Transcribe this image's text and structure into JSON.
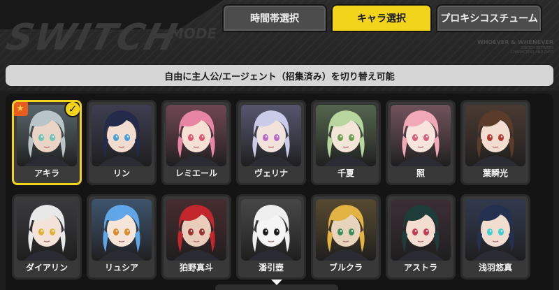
{
  "header": {
    "logo_text": "SWITCH",
    "logo_suffix": "MODE",
    "corner_title": "WHOEVER & WHENEVER",
    "corner_sub1": "SWITCH BETWEEN",
    "corner_sub2": "CHARACTERS AND DAYS"
  },
  "tabs": [
    {
      "label": "時間帯選択",
      "active": false
    },
    {
      "label": "キャラ選択",
      "active": true
    },
    {
      "label": "プロキシコスチューム",
      "active": false
    }
  ],
  "notice": "自由に主人公/エージェント（招集済み）を切り替え可能",
  "characters": [
    {
      "name": "アキラ",
      "selected": true,
      "hair": "#b9c4c8",
      "bg": "#5f6e74",
      "skin": "#e9d4c6",
      "eye": "#6fc3b5"
    },
    {
      "name": "リン",
      "selected": false,
      "hair": "#232a4a",
      "bg": "#3d3f55",
      "skin": "#f1dccf",
      "eye": "#4aa0d8"
    },
    {
      "name": "レミエール",
      "selected": false,
      "hair": "#e985a4",
      "bg": "#7a4a58",
      "skin": "#f6e0d6",
      "eye": "#e0566e"
    },
    {
      "name": "ヴェリナ",
      "selected": false,
      "hair": "#c9cbe8",
      "bg": "#5b5d7a",
      "skin": "#f2e2dc",
      "eye": "#b76bc7"
    },
    {
      "name": "千夏",
      "selected": false,
      "hair": "#b8d5a0",
      "bg": "#5a6e52",
      "skin": "#f3e5d8",
      "eye": "#6b9e4c"
    },
    {
      "name": "照",
      "selected": false,
      "hair": "#f1a9b7",
      "bg": "#7d5964",
      "skin": "#f7e4dc",
      "eye": "#d65f7a"
    },
    {
      "name": "葉瞬光",
      "selected": false,
      "hair": "#5b3b2a",
      "bg": "#4e3a30",
      "skin": "#f2ddd0",
      "eye": "#b5382e"
    },
    {
      "name": "ダイアリン",
      "selected": false,
      "hair": "#e8e8e8",
      "bg": "#3a3a3e",
      "skin": "#f3e2d8",
      "eye": "#e0b236"
    },
    {
      "name": "リュシア",
      "selected": false,
      "hair": "#5fa6e8",
      "bg": "#3f5a78",
      "skin": "#f5e4d8",
      "eye": "#d88b2a"
    },
    {
      "name": "狛野真斗",
      "selected": false,
      "hair": "#c4262e",
      "bg": "#4a2a2c",
      "skin": "#e9ccba",
      "eye": "#9a3232"
    },
    {
      "name": "潘引壺",
      "selected": false,
      "hair": "#efefef",
      "bg": "#4a4a4a",
      "skin": "#f5f5f5",
      "eye": "#1c1c1c"
    },
    {
      "name": "ブルクラ",
      "selected": false,
      "hair": "#e2b243",
      "bg": "#5e4d2e",
      "skin": "#e8d3bc",
      "eye": "#3f8a5a"
    },
    {
      "name": "アストラ",
      "selected": false,
      "hair": "#1e3c3a",
      "bg": "#3c2c34",
      "skin": "#f3ddd0",
      "eye": "#c23c54"
    },
    {
      "name": "浅羽悠真",
      "selected": false,
      "hair": "#233050",
      "bg": "#2f3a52",
      "skin": "#f0ddd0",
      "eye": "#3fd0d0"
    }
  ],
  "colors": {
    "accent": "#f2d41b",
    "badge_star": "#e85d1f"
  },
  "icons": {
    "star_badge": "star-icon",
    "check_badge": "check-icon",
    "scroll_down": "chevron-down-icon"
  }
}
